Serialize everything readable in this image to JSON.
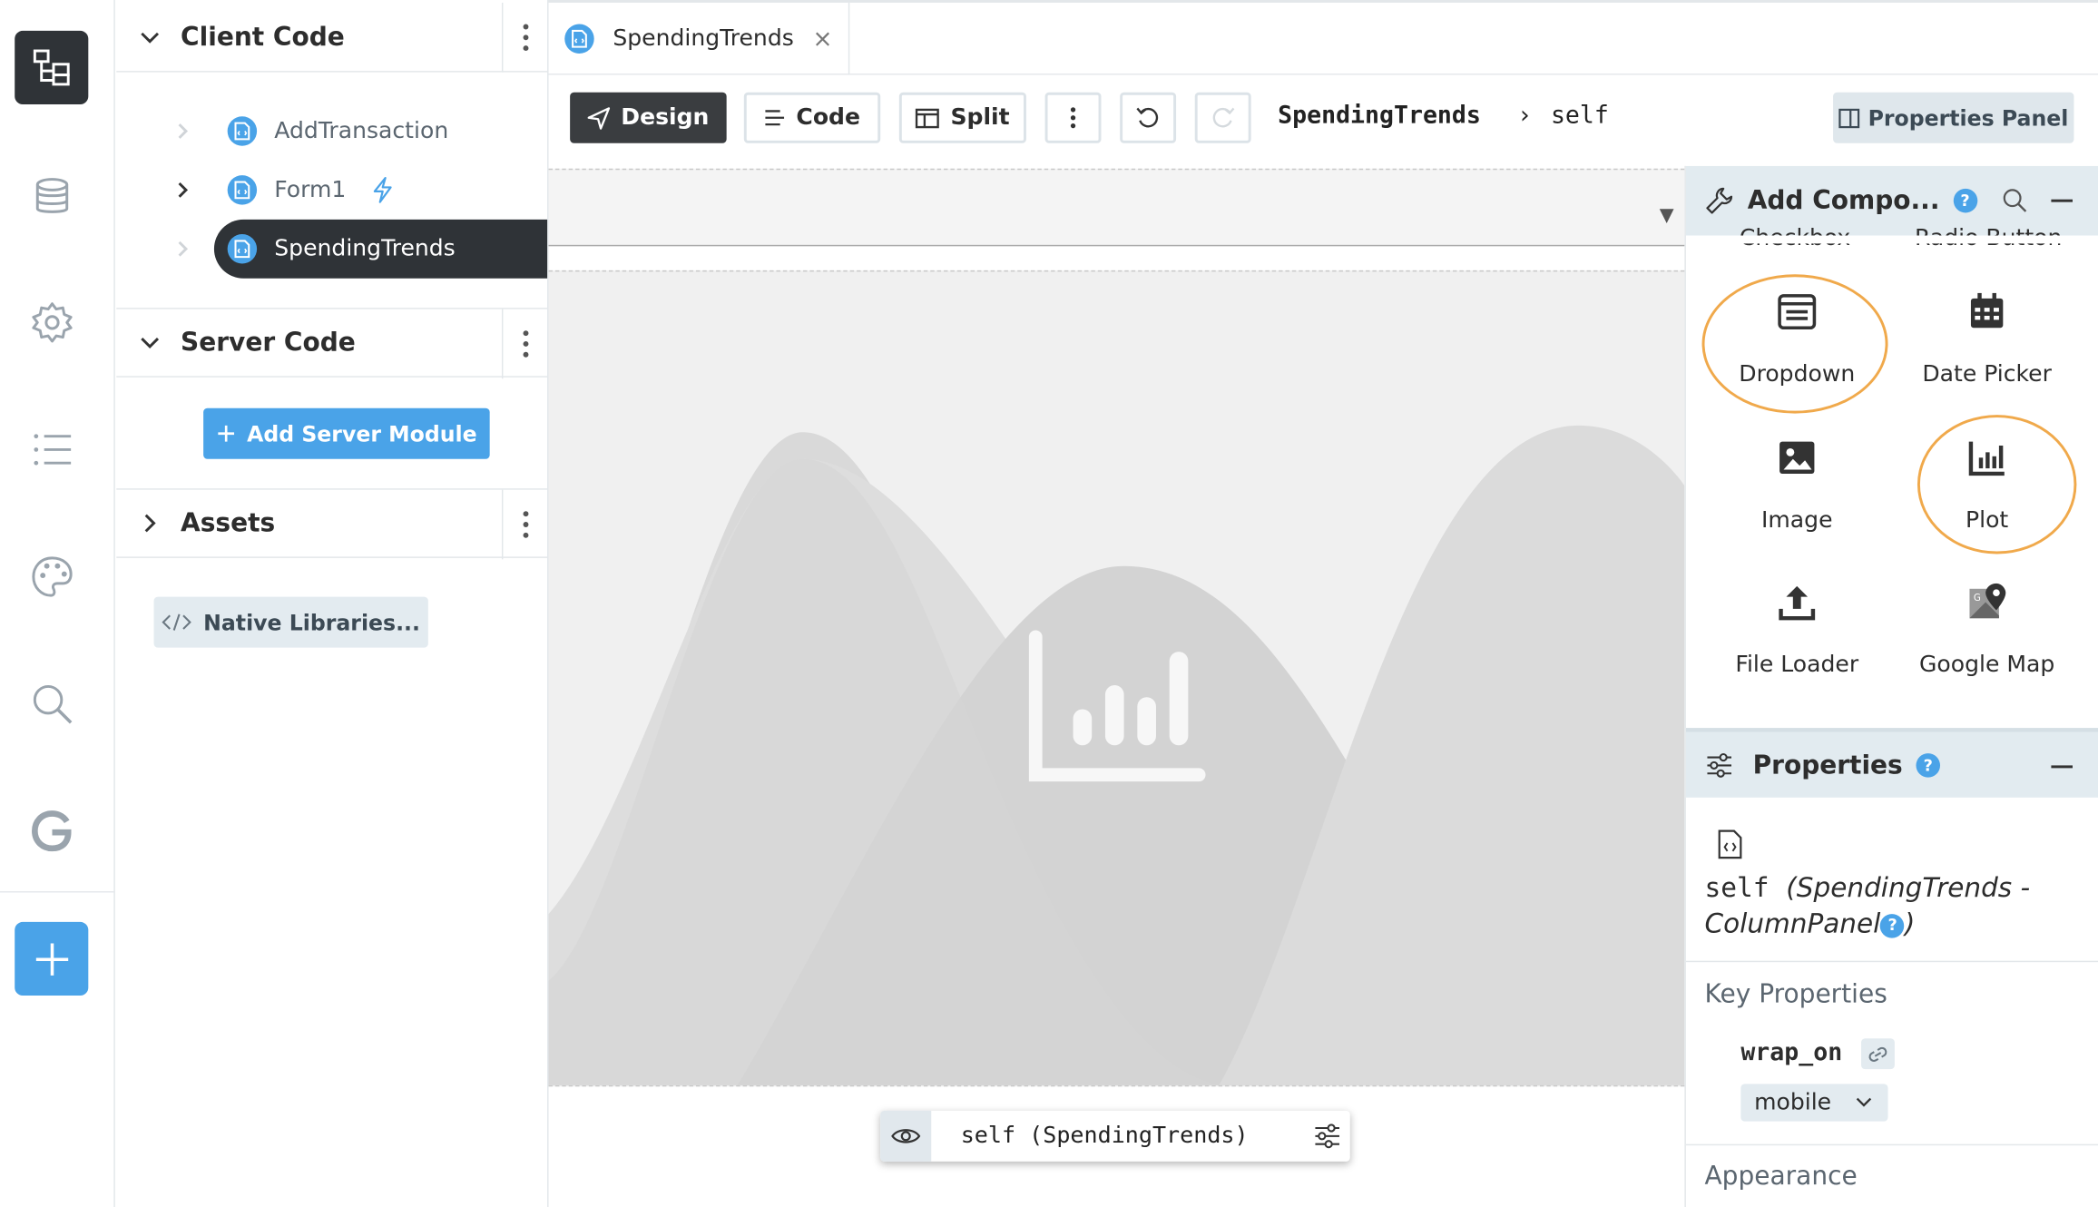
{
  "explorer": {
    "client_code_title": "Client Code",
    "client_items": [
      {
        "label": "AddTransaction"
      },
      {
        "label": "Form1"
      },
      {
        "label": "SpendingTrends"
      }
    ],
    "server_code_title": "Server Code",
    "add_server_label": "Add Server Module",
    "assets_title": "Assets",
    "native_libraries_label": "Native Libraries..."
  },
  "tabs": [
    {
      "label": "SpendingTrends",
      "close": "×"
    }
  ],
  "toolbar": {
    "design_label": "Design",
    "code_label": "Code",
    "split_label": "Split",
    "breadcrumb_form": "SpendingTrends",
    "breadcrumb_sep": "›",
    "breadcrumb_self": "self",
    "properties_panel_label": "Properties Panel"
  },
  "canvas": {
    "dropdown_arrow": "▼",
    "floating_bar_label": "self (SpendingTrends)"
  },
  "add_components": {
    "title": "Add Compo...",
    "help": "?",
    "cut_labels": [
      "Checkbox",
      "Radio Button"
    ],
    "items": [
      {
        "label": "Dropdown",
        "icon": "dropdown-icon",
        "highlighted": true
      },
      {
        "label": "Date Picker",
        "icon": "calendar-icon",
        "highlighted": false
      },
      {
        "label": "Image",
        "icon": "image-icon",
        "highlighted": false
      },
      {
        "label": "Plot",
        "icon": "plot-icon",
        "highlighted": true
      },
      {
        "label": "File Loader",
        "icon": "upload-icon",
        "highlighted": false
      },
      {
        "label": "Google Map",
        "icon": "map-icon",
        "highlighted": false
      }
    ]
  },
  "properties": {
    "title": "Properties",
    "help": "?",
    "self_name": "self",
    "self_type_open": "(SpendingTrends -",
    "self_type_cont": "ColumnPanel",
    "self_type_close": ")",
    "key_properties_label": "Key Properties",
    "wrap_on_label": "wrap_on",
    "wrap_on_value": "mobile",
    "appearance_label": "Appearance"
  },
  "colors": {
    "accent": "#4aa3e8",
    "highlight_ring": "#f0a94b",
    "dark": "#2f3337"
  }
}
